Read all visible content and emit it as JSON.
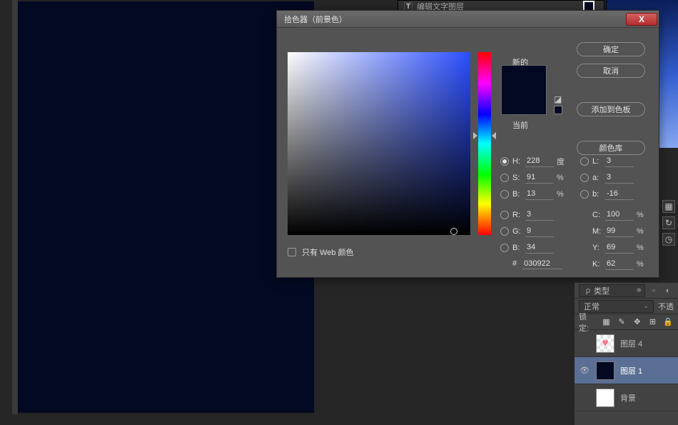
{
  "top_bar": {
    "icon_label": "T",
    "text": "编辑文字图层"
  },
  "dialog": {
    "title": "拾色器（前景色）",
    "close_glyph": "X",
    "buttons": {
      "ok": "确定",
      "cancel": "取消",
      "add_swatch": "添加到色板",
      "library": "颜色库"
    },
    "labels": {
      "new": "新的",
      "current": "当前"
    },
    "web_only": "只有 Web 颜色",
    "hsb": {
      "h_label": "H:",
      "h": "228",
      "h_unit": "度",
      "s_label": "S:",
      "s": "91",
      "s_unit": "%",
      "b_label": "B:",
      "b": "13",
      "b_unit": "%"
    },
    "lab": {
      "l_label": "L:",
      "l": "3",
      "a_label": "a:",
      "a": "3",
      "b_label": "b:",
      "b": "-16"
    },
    "rgb": {
      "r_label": "R:",
      "r": "3",
      "g_label": "G:",
      "g": "9",
      "b_label": "B:",
      "b": "34"
    },
    "cmyk": {
      "c_label": "C:",
      "c": "100",
      "m_label": "M:",
      "m": "99",
      "y_label": "Y:",
      "y": "69",
      "k_label": "K:",
      "k": "62",
      "unit": "%"
    },
    "hex_label": "#",
    "hex": "030922"
  },
  "panels": {
    "search_icon": "ρ",
    "kind_label": "类型",
    "blend_mode": "正常",
    "opacity_label": "不透",
    "lock_label": "锁定:",
    "layers": [
      {
        "name": "图层 4",
        "visible": false,
        "thumb": "heart",
        "active": false
      },
      {
        "name": "图层 1",
        "visible": true,
        "thumb": "dark",
        "active": true
      },
      {
        "name": "背景",
        "visible": false,
        "thumb": "white",
        "active": false
      }
    ]
  }
}
